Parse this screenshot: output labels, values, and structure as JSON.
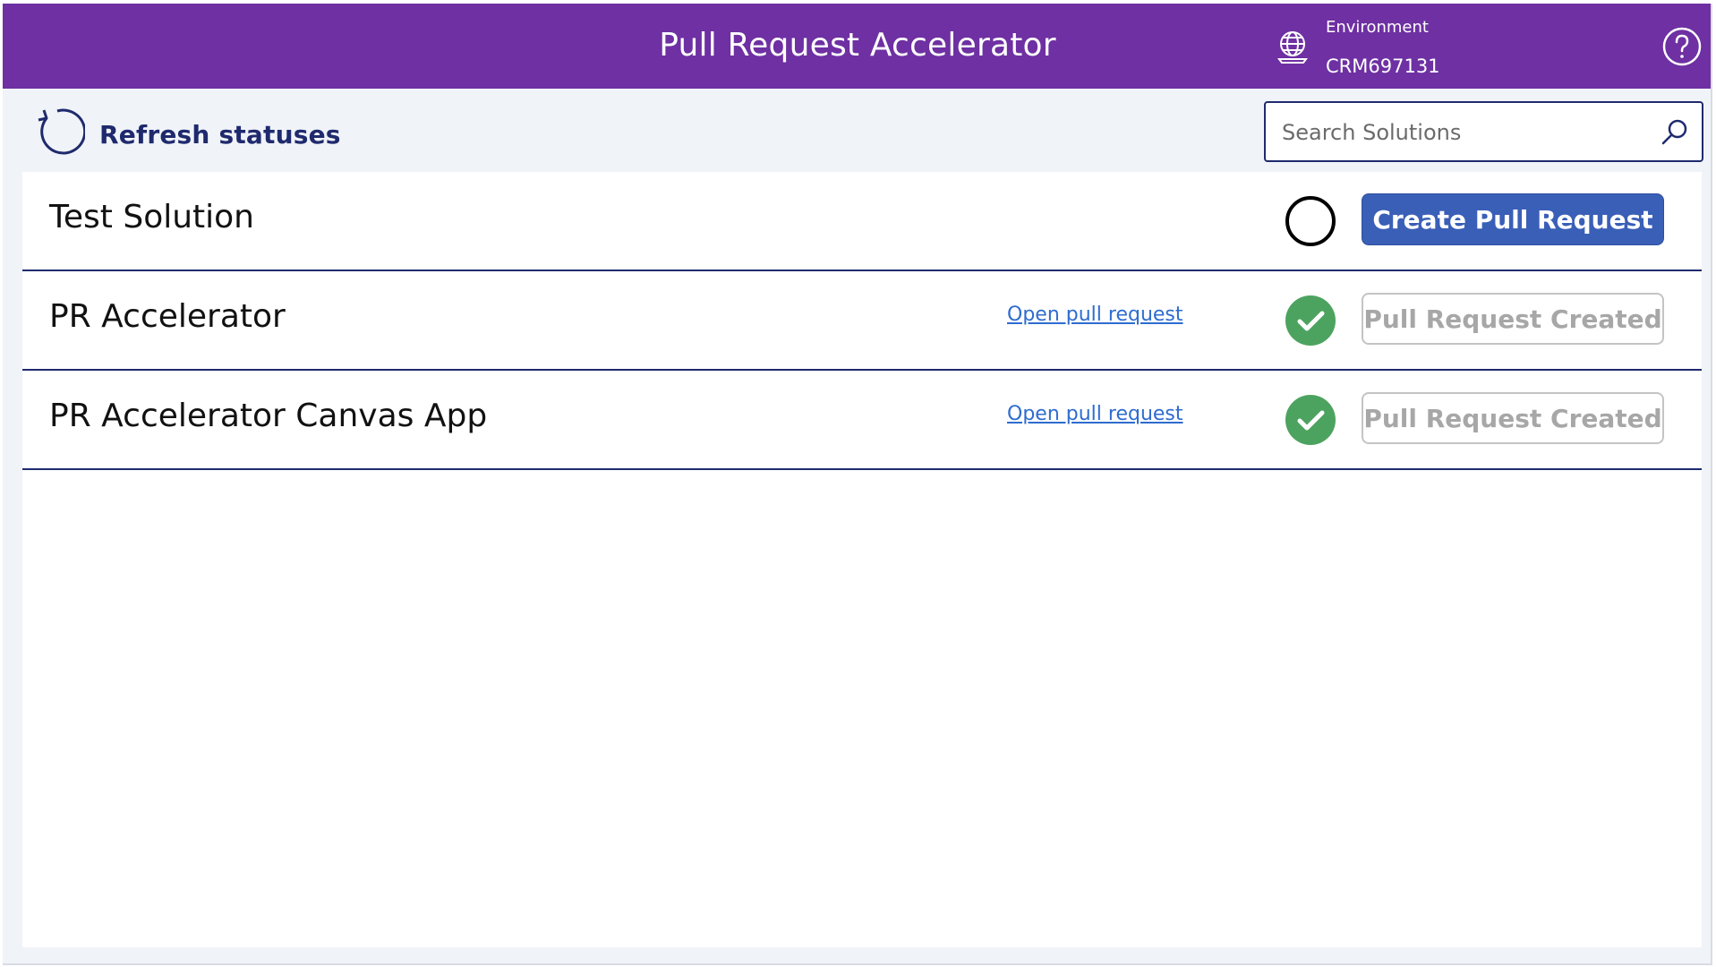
{
  "app": {
    "title": "Pull Request Accelerator",
    "environment_label": "Environment",
    "environment_value": "CRM697131",
    "icons": {
      "globe": "globe-icon",
      "help": "help-circle-icon"
    },
    "colors": {
      "header": "#6e30a2",
      "primary": "#3a5fb7",
      "accent": "#1f2a6d",
      "success": "#4ca35f"
    }
  },
  "toolbar": {
    "refresh_label": "Refresh statuses",
    "search_placeholder": "Search Solutions",
    "icons": {
      "refresh": "refresh-icon",
      "search": "search-icon"
    }
  },
  "solutions": [
    {
      "name": "Test Solution",
      "link": "",
      "status": "pending",
      "button_label": "Create Pull Request",
      "button_state": "enabled"
    },
    {
      "name": "PR Accelerator",
      "link": "Open pull request",
      "status": "done",
      "button_label": "Pull Request Created",
      "button_state": "disabled"
    },
    {
      "name": "PR Accelerator Canvas App",
      "link": "Open pull request",
      "status": "done",
      "button_label": "Pull Request Created",
      "button_state": "disabled"
    }
  ]
}
